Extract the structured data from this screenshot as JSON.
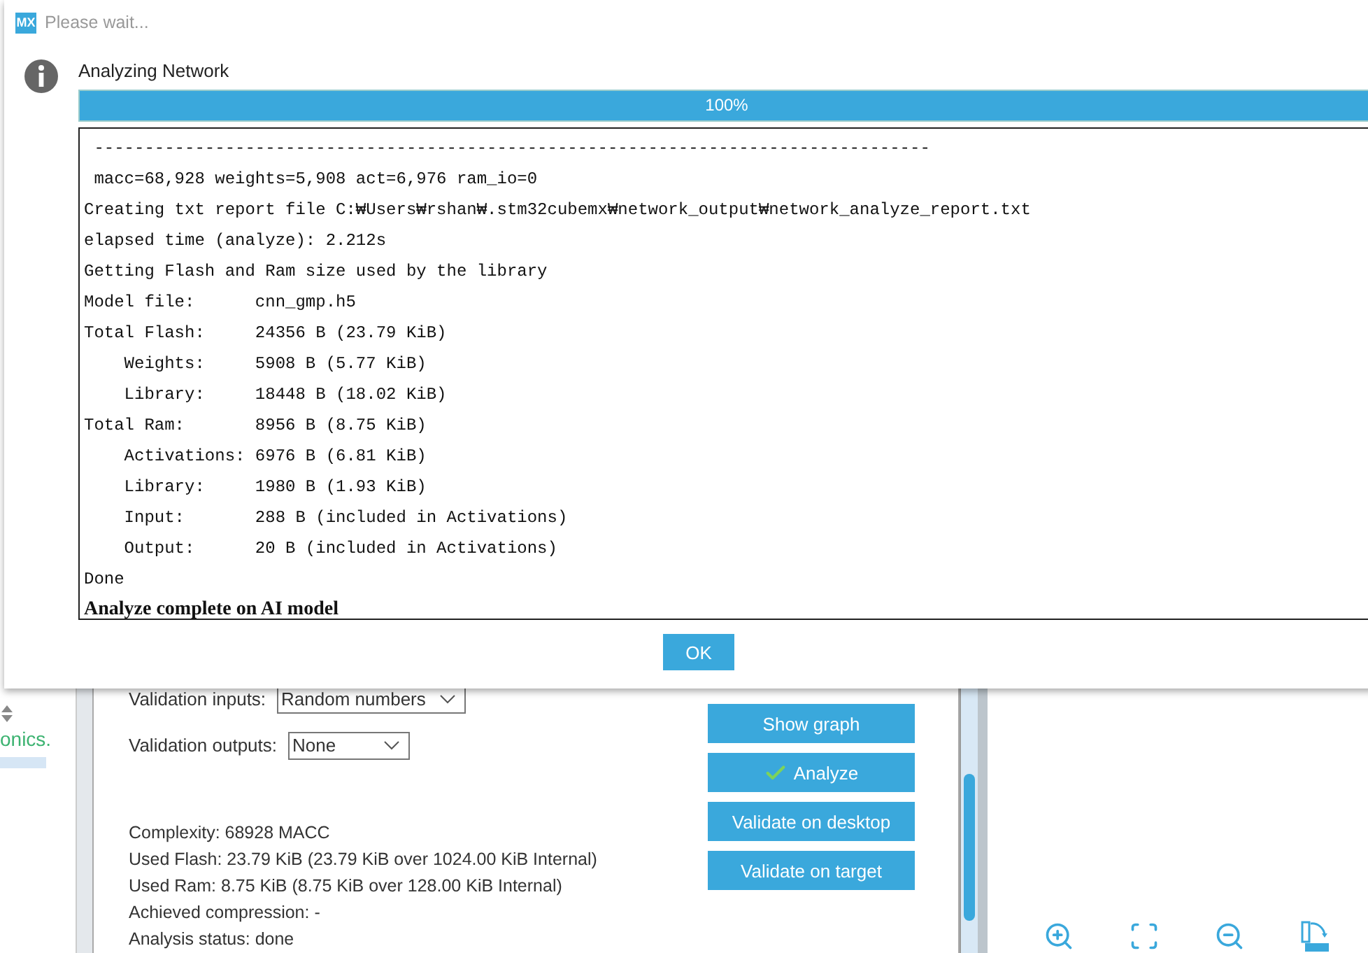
{
  "dialog": {
    "title": "Please wait...",
    "logo": "MX",
    "heading": "Analyzing Network",
    "progress": {
      "level": 1,
      "label": "100%"
    },
    "log": [
      {
        "kind": "mono",
        "text": " -----------------------------------------------------------------------------------"
      },
      {
        "kind": "mono",
        "text": " macc=68,928 weights=5,908 act=6,976 ram_io=0"
      },
      {
        "kind": "mono",
        "text": "Creating txt report file C:₩Users₩rshan₩.stm32cubemx₩network_output₩network_analyze_report.txt"
      },
      {
        "kind": "mono",
        "text": "elapsed time (analyze): 2.212s"
      },
      {
        "kind": "mono",
        "text": "Getting Flash and Ram size used by the library"
      },
      {
        "kind": "mono",
        "text": "Model file:      cnn_gmp.h5"
      },
      {
        "kind": "mono",
        "text": "Total Flash:     24356 B (23.79 KiB)"
      },
      {
        "kind": "mono",
        "text": "    Weights:     5908 B (5.77 KiB)"
      },
      {
        "kind": "mono",
        "text": "    Library:     18448 B (18.02 KiB)"
      },
      {
        "kind": "mono",
        "text": "Total Ram:       8956 B (8.75 KiB)"
      },
      {
        "kind": "mono",
        "text": "    Activations: 6976 B (6.81 KiB)"
      },
      {
        "kind": "mono",
        "text": "    Library:     1980 B (1.93 KiB)"
      },
      {
        "kind": "mono",
        "text": "    Input:       288 B (included in Activations)"
      },
      {
        "kind": "mono",
        "text": "    Output:      20 B (included in Activations)"
      },
      {
        "kind": "mono",
        "text": "Done"
      },
      {
        "kind": "bold",
        "text": "Analyze complete on AI model"
      }
    ],
    "ok_button": "OK"
  },
  "sidebar": {
    "item_text": "onics."
  },
  "validation": {
    "inputs_label": "Validation inputs:",
    "inputs_value": "Random numbers",
    "outputs_label": "Validation outputs:",
    "outputs_value": "None"
  },
  "stats": [
    "Complexity:  68928 MACC",
    "Used Flash: 23.79 KiB (23.79 KiB over 1024.00 KiB Internal)",
    "Used Ram: 8.75 KiB (8.75 KiB over 128.00 KiB Internal)",
    "Achieved compression: -",
    "Analysis status: done"
  ],
  "actions": [
    {
      "label": "Show graph",
      "checked": false
    },
    {
      "label": "Analyze",
      "checked": true
    },
    {
      "label": "Validate on desktop",
      "checked": false
    },
    {
      "label": "Validate on target",
      "checked": false
    }
  ]
}
